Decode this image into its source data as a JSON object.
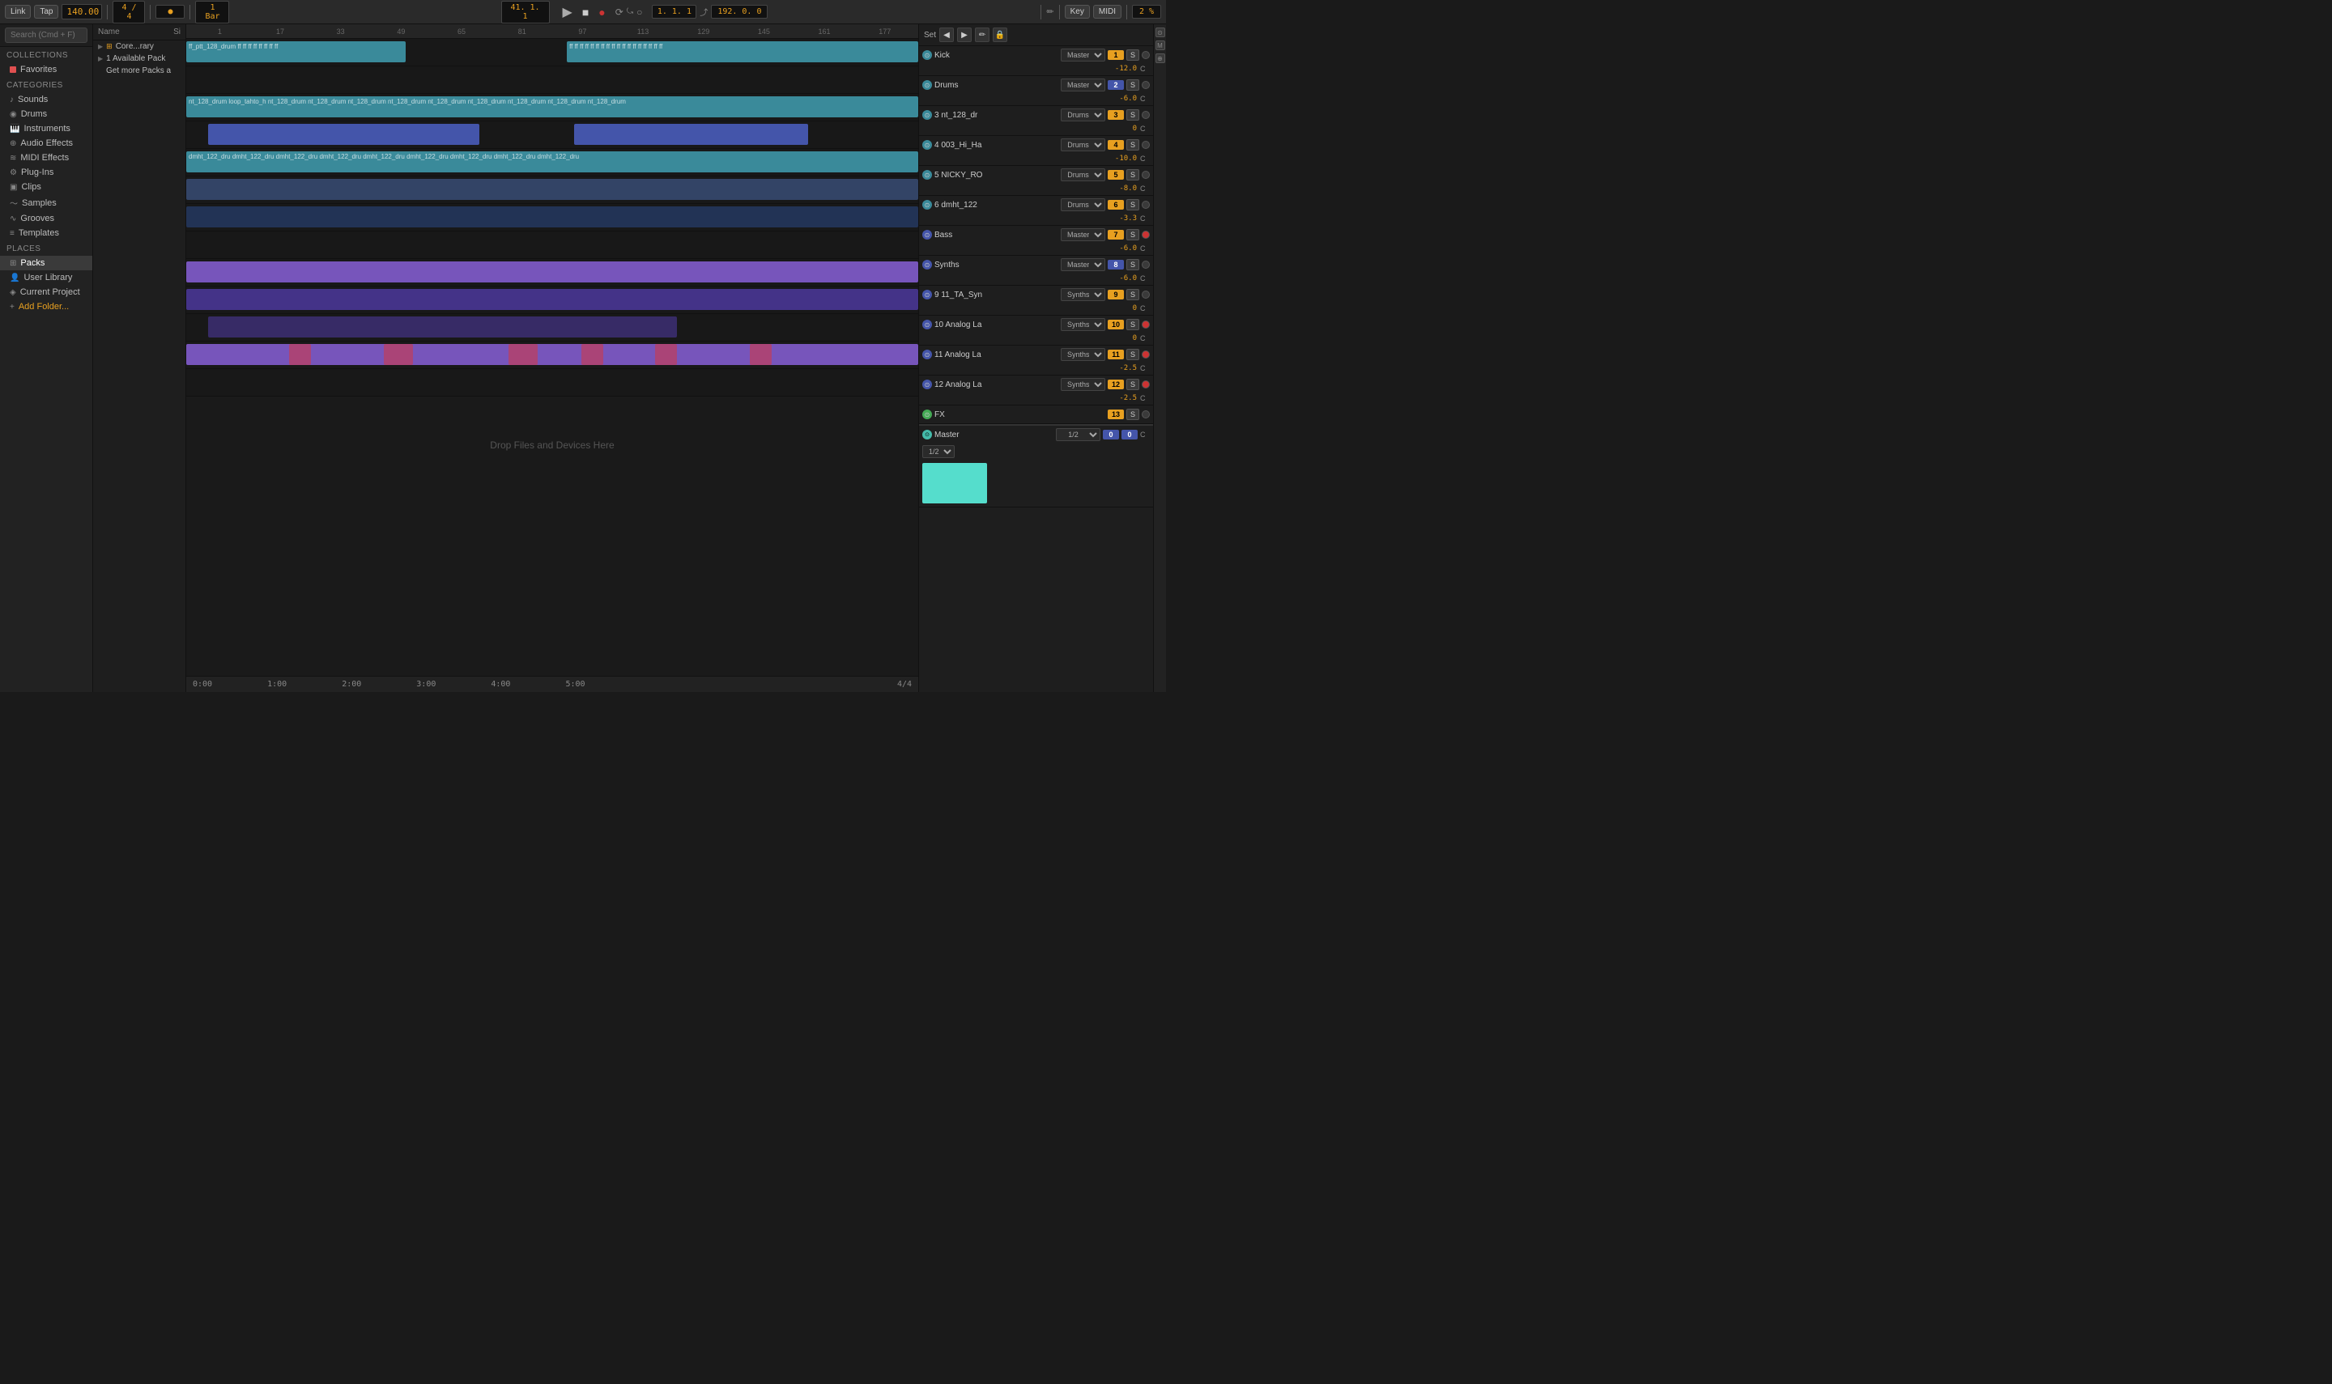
{
  "toolbar": {
    "link": "Link",
    "tap": "Tap",
    "bpm": "140.00",
    "time_sig": "4 / 4",
    "metro": "●",
    "bar_setting": "1 Bar",
    "position": "41. 1. 1",
    "play": "▶",
    "stop": "■",
    "record": "●",
    "loop_start": "1. 1. 1",
    "tempo_right": "192. 0. 0",
    "key": "Key",
    "midi": "MIDI",
    "zoom": "2 %"
  },
  "sidebar": {
    "search_placeholder": "Search (Cmd + F)",
    "collections_label": "Collections",
    "favorites": "Favorites",
    "categories_label": "Categories",
    "sounds": "Sounds",
    "drums": "Drums",
    "instruments": "Instruments",
    "audio_effects": "Audio Effects",
    "midi_effects": "MIDI Effects",
    "plug_ins": "Plug-Ins",
    "clips": "Clips",
    "samples": "Samples",
    "grooves": "Grooves",
    "templates": "Templates",
    "places_label": "Places",
    "packs": "Packs",
    "user_library": "User Library",
    "current_project": "Current Project",
    "add_folder": "Add Folder..."
  },
  "browser": {
    "name_col": "Name",
    "size_col": "Si",
    "core_library": "Core...rary",
    "available_pack": "1 Available Pack",
    "get_more_packs": "Get more Packs a"
  },
  "timeline": {
    "markers": [
      "1",
      "17",
      "33",
      "49",
      "65",
      "81",
      "97",
      "113",
      "129",
      "145",
      "161",
      "177"
    ]
  },
  "tracks": [
    {
      "id": 1,
      "name": "Kick",
      "dest": "Master",
      "num": "1",
      "db": "-12.0",
      "c": "C",
      "s": "S",
      "color": "cyan",
      "clips": [
        {
          "start": 0,
          "width": 42,
          "type": "cyan",
          "label": "ff_ptt_128_drum"
        },
        {
          "start": 56,
          "width": 44,
          "type": "cyan",
          "label": "ff ff ff ff ff ff ff ff ff ff ff"
        }
      ]
    },
    {
      "id": 2,
      "name": "Drums",
      "dest": "Master",
      "num": "2",
      "db": "-6.0",
      "c": "C",
      "s": "S",
      "color": "cyan",
      "clips": []
    },
    {
      "id": 3,
      "name": "3 nt_128_dr",
      "dest": "Drums",
      "num": "3",
      "db": "0",
      "c": "C",
      "s": "S",
      "color": "cyan",
      "clips": [
        {
          "start": 0,
          "width": 100,
          "type": "cyan",
          "label": "nt_128_drum loop_tahto..."
        }
      ]
    },
    {
      "id": 4,
      "name": "4 003_Hi_Ha",
      "dest": "Drums",
      "num": "4",
      "db": "-10.0",
      "c": "C",
      "s": "S",
      "color": "cyan",
      "clips": [
        {
          "start": 5,
          "width": 46,
          "type": "blue",
          "label": ""
        },
        {
          "start": 55,
          "width": 40,
          "type": "blue",
          "label": ""
        }
      ]
    },
    {
      "id": 5,
      "name": "5 NICKY_RO",
      "dest": "Drums",
      "num": "5",
      "db": "-8.0",
      "c": "C",
      "s": "S",
      "color": "cyan",
      "clips": [
        {
          "start": 0,
          "width": 100,
          "type": "cyan",
          "label": "dmht_122_dr..."
        }
      ]
    },
    {
      "id": 6,
      "name": "6 dmht_122",
      "dest": "Drums",
      "num": "6",
      "db": "-3.3",
      "c": "C",
      "s": "S",
      "color": "cyan",
      "clips": [
        {
          "start": 0,
          "width": 100,
          "type": "dark-blue",
          "label": ""
        }
      ]
    },
    {
      "id": 7,
      "name": "Bass",
      "dest": "Master",
      "num": "7",
      "db": "-6.0",
      "c": "C",
      "s": "S",
      "color": "blue",
      "clips": []
    },
    {
      "id": 8,
      "name": "Synths",
      "dest": "Master",
      "num": "8",
      "db": "-6.0",
      "c": "C",
      "s": "S",
      "color": "blue",
      "clips": []
    },
    {
      "id": 9,
      "name": "9 11_TA_Syn",
      "dest": "Synths",
      "num": "9",
      "db": "0",
      "c": "C",
      "s": "S",
      "color": "blue",
      "clips": [
        {
          "start": 0,
          "width": 100,
          "type": "purple",
          "label": ""
        }
      ]
    },
    {
      "id": 10,
      "name": "10 Analog La",
      "dest": "Synths",
      "num": "10",
      "db": "0",
      "c": "C",
      "s": "S",
      "color": "blue",
      "clips": [
        {
          "start": 0,
          "width": 100,
          "type": "dark-purple",
          "label": ""
        }
      ]
    },
    {
      "id": 11,
      "name": "11 Analog La",
      "dest": "Synths",
      "num": "11",
      "db": "-2.5",
      "c": "C",
      "s": "S",
      "color": "blue",
      "muted": true,
      "clips": [
        {
          "start": 5,
          "width": 65,
          "type": "dark-purple",
          "label": ""
        }
      ]
    },
    {
      "id": 12,
      "name": "12 Analog La",
      "dest": "Synths",
      "num": "12",
      "db": "-2.5",
      "c": "C",
      "s": "S",
      "color": "blue",
      "clips": [
        {
          "start": 0,
          "width": 100,
          "type": "purple",
          "label": ""
        },
        {
          "start": 12,
          "width": 55,
          "type": "pink",
          "label": ""
        },
        {
          "start": 18,
          "width": 5,
          "type": "pink",
          "label": ""
        },
        {
          "start": 29,
          "width": 4,
          "type": "pink",
          "label": ""
        },
        {
          "start": 45,
          "width": 6,
          "type": "pink",
          "label": ""
        },
        {
          "start": 54,
          "width": 4,
          "type": "pink",
          "label": ""
        },
        {
          "start": 66,
          "width": 3,
          "type": "pink",
          "label": ""
        },
        {
          "start": 78,
          "width": 3,
          "type": "pink",
          "label": ""
        }
      ]
    },
    {
      "id": 13,
      "name": "FX",
      "dest": "",
      "num": "13",
      "db": "",
      "c": "",
      "s": "S",
      "color": "green",
      "clips": []
    }
  ],
  "master": {
    "name": "Master",
    "dest1": "1/2",
    "dest2": "1/2",
    "num1": "0",
    "num2": "0",
    "c": "C"
  },
  "drop_zone": {
    "label": "Drop Files and Devices Here"
  },
  "bottom_bar": {
    "time1": "0:00",
    "time2": "1:00",
    "time3": "2:00",
    "time4": "3:00",
    "time5": "4:00",
    "time6": "5:00",
    "beat_count": "4/4"
  }
}
